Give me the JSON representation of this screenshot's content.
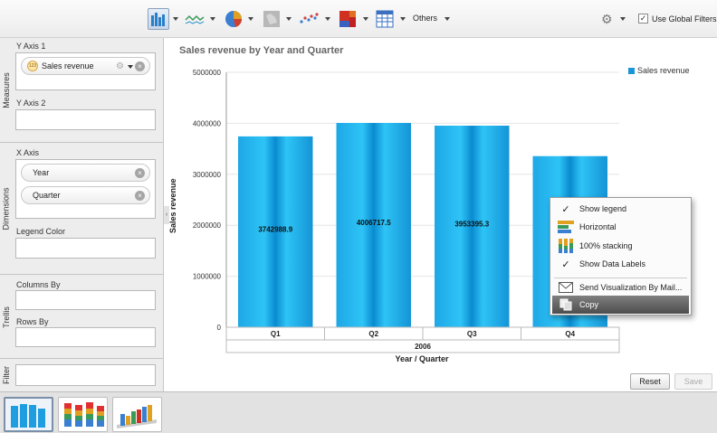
{
  "toolbar": {
    "chart_types": [
      {
        "name": "bar-chart",
        "selected": true
      },
      {
        "name": "line-chart",
        "selected": false
      },
      {
        "name": "pie-chart",
        "selected": false
      },
      {
        "name": "map-chart",
        "selected": false
      },
      {
        "name": "scatter-chart",
        "selected": false
      },
      {
        "name": "heatmap-chart",
        "selected": false
      },
      {
        "name": "table-chart",
        "selected": false
      }
    ],
    "others_label": "Others",
    "use_global_filters_label": "Use Global Filters",
    "use_global_filters_checked": true
  },
  "panel": {
    "measures_label": "Measures",
    "y_axis_1_label": "Y Axis 1",
    "y_axis_1_pill": "Sales revenue",
    "y_axis_2_label": "Y Axis 2",
    "dimensions_label": "Dimensions",
    "x_axis_label": "X Axis",
    "x_axis_pills": [
      "Year",
      "Quarter"
    ],
    "legend_color_label": "Legend Color",
    "trellis_label": "Trellis",
    "columns_by_label": "Columns By",
    "rows_by_label": "Rows By",
    "filter_label": "Filter"
  },
  "chart_data": {
    "type": "bar",
    "title": "Sales revenue by Year and Quarter",
    "categories": [
      "Q1",
      "Q2",
      "Q3",
      "Q4"
    ],
    "group_label": "2006",
    "series": [
      {
        "name": "Sales revenue",
        "values": [
          3742988.9,
          4006717.5,
          3953395.3,
          3356000
        ],
        "data_labels": [
          "3742988.9",
          "4006717.5",
          "3953395.3",
          ""
        ]
      }
    ],
    "xlabel": "Year / Quarter",
    "ylabel": "Sales revenue",
    "ylim": [
      0,
      5000000
    ],
    "yticks": [
      "0",
      "1000000",
      "2000000",
      "3000000",
      "4000000",
      "5000000"
    ],
    "legend_position": "top-right",
    "bar_color": "#1b95d6"
  },
  "context_menu": {
    "items": [
      {
        "label": "Show legend",
        "icon": "check-icon"
      },
      {
        "label": "Horizontal",
        "icon": "horizontal-bars-icon"
      },
      {
        "label": "100% stacking",
        "icon": "stacked-bars-icon"
      },
      {
        "label": "Show Data Labels",
        "icon": "check-icon"
      },
      {
        "label": "Send Visualization By Mail...",
        "icon": "mail-icon"
      },
      {
        "label": "Copy",
        "icon": "copy-icon",
        "highlighted": true
      }
    ]
  },
  "buttons": {
    "reset_label": "Reset",
    "save_label": "Save"
  }
}
